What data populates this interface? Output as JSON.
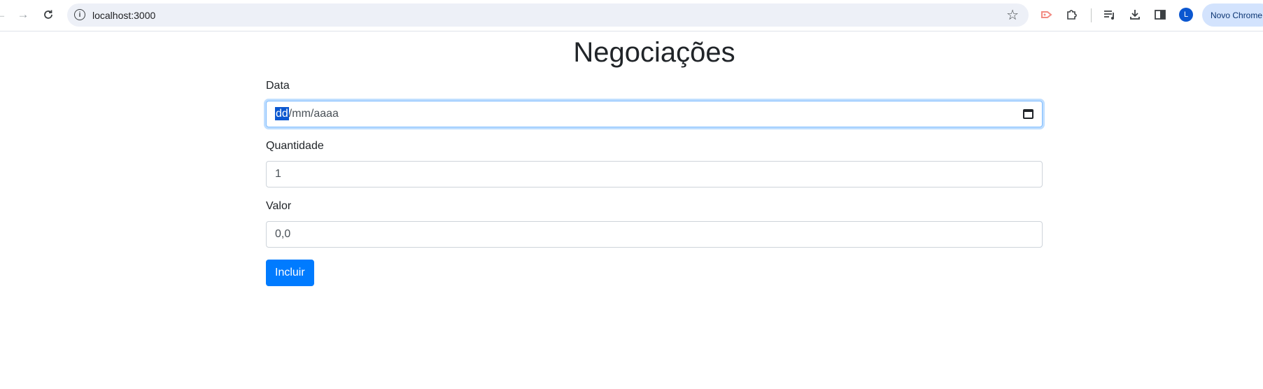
{
  "browser": {
    "url": "localhost:3000",
    "profile_label": "Novo Chrome",
    "avatar_initial": "L",
    "icons": [
      "back-icon",
      "forward-icon",
      "reload-icon",
      "info-icon",
      "star-icon",
      "extension-red-icon",
      "puzzle-icon",
      "reading-list-icon",
      "download-icon",
      "side-panel-icon"
    ]
  },
  "page": {
    "title": "Negociações",
    "form": {
      "date_label": "Data",
      "date_placeholder_day": "dd",
      "date_placeholder_rest": "/mm/aaaa",
      "quantity_label": "Quantidade",
      "quantity_value": "1",
      "value_label": "Valor",
      "value_value": "0,0",
      "submit_label": "Incluir"
    }
  },
  "colors": {
    "primary": "#007bff",
    "focus_border": "#80bdff",
    "selection": "#0b57d0"
  }
}
